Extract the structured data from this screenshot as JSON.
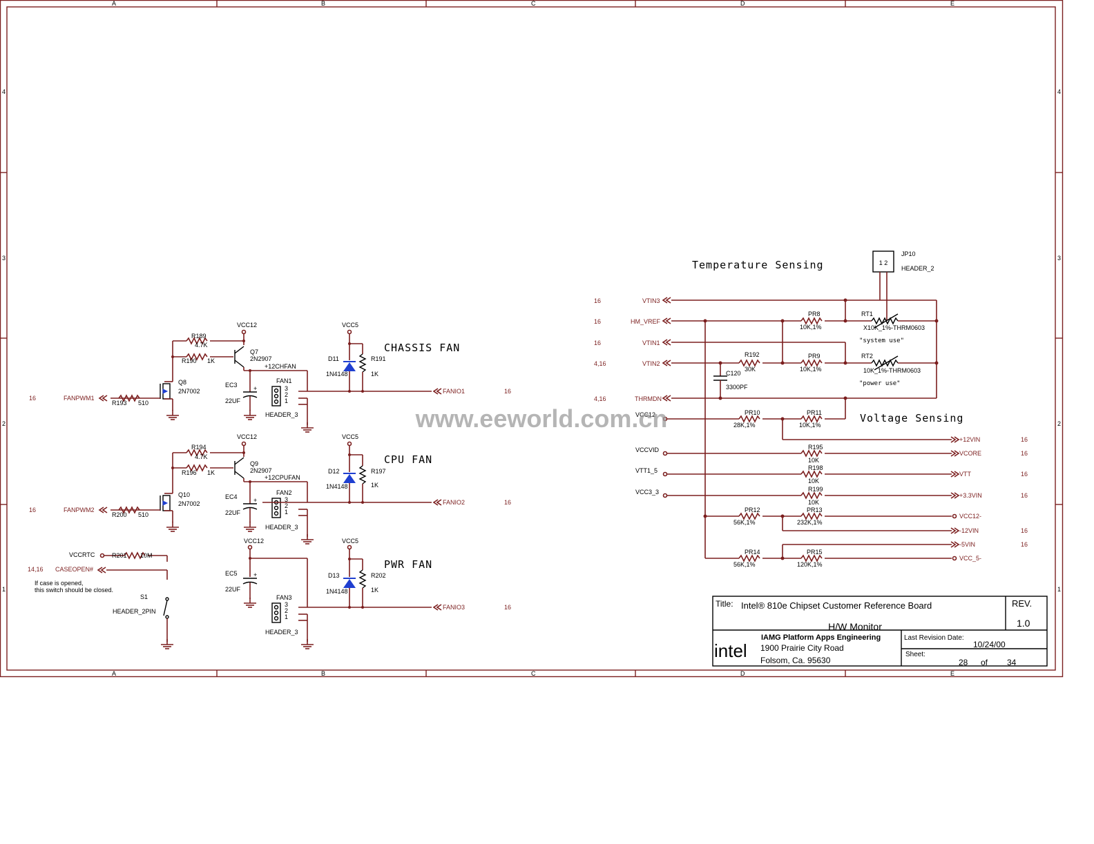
{
  "frame": {
    "col_letters": [
      "A",
      "B",
      "C",
      "D",
      "E"
    ],
    "row_numbers": [
      "4",
      "3",
      "2",
      "1"
    ]
  },
  "sections": {
    "chassis_fan": "CHASSIS FAN",
    "cpu_fan": "CPU FAN",
    "pwr_fan": "PWR FAN",
    "temperature": "Temperature Sensing",
    "voltage": "Voltage Sensing"
  },
  "fan1": {
    "vcc12": "VCC12",
    "vcc5": "VCC5",
    "r_a": "R189",
    "r_a_val": "4.7K",
    "r_b": "R190",
    "r_b_val": "1K",
    "q_pnp": "Q7",
    "q_pnp_part": "2N2907",
    "net": "+12CHFAN",
    "cap": "EC3",
    "cap_val": "22UF",
    "q_fet": "Q8",
    "q_fet_part": "2N7002",
    "r_in": "R193",
    "r_in_val": "510",
    "in_net": "FANPWM1",
    "in_ref": "16",
    "hdr": "FAN1",
    "hdr_type": "HEADER_3",
    "pins": [
      "3",
      "2",
      "1"
    ],
    "diode": "D11",
    "diode_part": "1N4148",
    "r_pu": "R191",
    "r_pu_val": "1K",
    "out_net": "FANIO1",
    "out_ref": "16"
  },
  "fan2": {
    "vcc12": "VCC12",
    "vcc5": "VCC5",
    "r_a": "R194",
    "r_a_val": "4.7K",
    "r_b": "R196",
    "r_b_val": "1K",
    "q_pnp": "Q9",
    "q_pnp_part": "2N2907",
    "net": "+12CPUFAN",
    "cap": "EC4",
    "cap_val": "22UF",
    "q_fet": "Q10",
    "q_fet_part": "2N7002",
    "r_in": "R200",
    "r_in_val": "510",
    "in_net": "FANPWM2",
    "in_ref": "16",
    "hdr": "FAN2",
    "hdr_type": "HEADER_3",
    "pins": [
      "3",
      "2",
      "1"
    ],
    "diode": "D12",
    "diode_part": "1N4148",
    "r_pu": "R197",
    "r_pu_val": "1K",
    "out_net": "FANIO2",
    "out_ref": "16"
  },
  "fan3": {
    "vcc12": "VCC12",
    "vcc5": "VCC5",
    "cap": "EC5",
    "cap_val": "22UF",
    "hdr": "FAN3",
    "hdr_type": "HEADER_3",
    "pins": [
      "3",
      "2",
      "1"
    ],
    "diode": "D13",
    "diode_part": "1N4148",
    "r_pu": "R202",
    "r_pu_val": "1K",
    "out_net": "FANIO3",
    "out_ref": "16"
  },
  "case": {
    "vccrtc": "VCCRTC",
    "r": "R201",
    "r_val": "10M",
    "net": "CASEOPEN#",
    "ref": "14,16",
    "note1": "If case is opened,",
    "note2": "this switch should be closed.",
    "sw": "S1",
    "sw_type": "HEADER_2PIN"
  },
  "temp": {
    "jp": "JP10",
    "jp_type": "HEADER_2",
    "jp_pins": "1 2",
    "vtin3": "VTIN3",
    "vtin3_ref": "16",
    "hm_vref": "HM_VREF",
    "hm_vref_ref": "16",
    "vtin1": "VTIN1",
    "vtin1_ref": "16",
    "vtin2": "VTIN2",
    "vtin2_ref": "4,16",
    "thrmdn": "THRMDN",
    "thrmdn_ref": "4,16",
    "pr8": "PR8",
    "pr8_val": "10K,1%",
    "pr9": "PR9",
    "pr9_val": "10K,1%",
    "r192": "R192",
    "r192_val": "30K",
    "c120": "C120",
    "c120_val": "3300PF",
    "rt1": "RT1",
    "rt1_val": "X10K_1%-THRM0603",
    "rt1_use": "\"system use\"",
    "rt2": "RT2",
    "rt2_val": "10K_1%-THRM0603",
    "rt2_use": "\"power use\""
  },
  "volt": {
    "vcc12": "VCC12",
    "pr10": "PR10",
    "pr10_val": "28K,1%",
    "pr11": "PR11",
    "pr11_val": "10K,1%",
    "p12vin": "+12VIN",
    "p12vin_ref": "16",
    "vccvid": "VCCVID",
    "r195": "R195",
    "r195_val": "10K",
    "vcore": "VCORE",
    "vcore_ref": "16",
    "vtt1_5": "VTT1_5",
    "r198": "R198",
    "r198_val": "10K",
    "vtt": "VTT",
    "vtt_ref": "16",
    "vcc3_3": "VCC3_3",
    "r199": "R199",
    "r199_val": "10K",
    "p33vin": "+3.3VIN",
    "p33vin_ref": "16",
    "pr12": "PR12",
    "pr12_val": "56K,1%",
    "pr13": "PR13",
    "pr13_val": "232K,1%",
    "vcc12m": "VCC12-",
    "m12vin": "-12VIN",
    "m12vin_ref": "16",
    "m5vin": "-5VIN",
    "m5vin_ref": "16",
    "pr14": "PR14",
    "pr14_val": "56K,1%",
    "pr15": "PR15",
    "pr15_val": "120K,1%",
    "vcc5m": "VCC_5-"
  },
  "watermark": "www.eeworld.com.cn",
  "title_block": {
    "title_label": "Title:",
    "title": "Intel® 810e Chipset Customer Reference Board",
    "subtitle": "H/W Monitor",
    "rev_label": "REV.",
    "rev": "1.0",
    "logo": "intel",
    "org": "IAMG Platform Apps Engineering",
    "addr1": "1900 Prairie City Road",
    "addr2": "Folsom, Ca. 95630",
    "last_rev_label": "Last Revision Date:",
    "last_rev": "10/24/00",
    "sheet_label": "Sheet:",
    "sheet": "28",
    "of": "of",
    "total": "34"
  }
}
